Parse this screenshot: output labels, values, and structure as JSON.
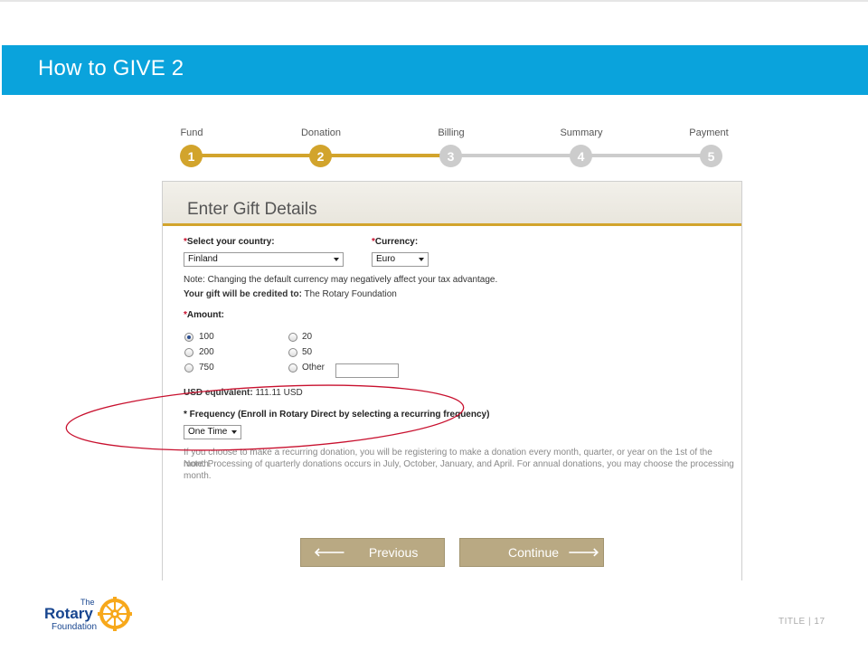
{
  "banner": {
    "title": "How to GIVE 2"
  },
  "stepper": {
    "steps": [
      {
        "label": "Fund",
        "number": "1"
      },
      {
        "label": "Donation",
        "number": "2"
      },
      {
        "label": "Billing",
        "number": "3"
      },
      {
        "label": "Summary",
        "number": "4"
      },
      {
        "label": "Payment",
        "number": "5"
      }
    ],
    "active_color": "#d2a42c",
    "inactive_color": "#cccccc"
  },
  "form": {
    "title": "Enter Gift Details",
    "required_mark": "*",
    "country_label": "Select your country:",
    "country_value": "Finland",
    "currency_label": "Currency:",
    "currency_value": "Euro",
    "note": "Note: Changing the default currency may negatively affect your tax advantage.",
    "credit_label": "Your gift will be credited to:",
    "credit_value": "The Rotary Foundation",
    "amount_label": "Amount:",
    "amounts": [
      {
        "value": "100",
        "checked": true
      },
      {
        "value": "20",
        "checked": false
      },
      {
        "value": "200",
        "checked": false
      },
      {
        "value": "50",
        "checked": false
      },
      {
        "value": "750",
        "checked": false
      },
      {
        "value": "Other",
        "checked": false
      }
    ],
    "usd_label": "USD equivalent:",
    "usd_value": "111.11 USD",
    "frequency_label": "* Frequency (Enroll in Rotary Direct by selecting a recurring frequency)",
    "frequency_value": "One Time",
    "recurring_note_1": "If you choose to make a recurring donation, you will be registering to make a donation every month, quarter, or year on the 1st of the month.",
    "recurring_note_2": "Note: Processing of quarterly donations occurs in July, October, January, and April. For annual donations, you may choose the processing",
    "recurring_note_3": "month."
  },
  "buttons": {
    "previous_glyph": "🡐",
    "previous_label": "Previous",
    "continue_label": "Continue",
    "continue_glyph": "🡒"
  },
  "footer": {
    "logo_the": "The",
    "logo_rotary": "Rotary",
    "logo_foundation": "Foundation",
    "title_text": "TITLE | 17"
  },
  "colors": {
    "banner": "#0aa3dc",
    "accent": "#d2a42c",
    "button": "#b9a983",
    "annotation": "#c8102e",
    "rotary_blue": "#17458f"
  }
}
